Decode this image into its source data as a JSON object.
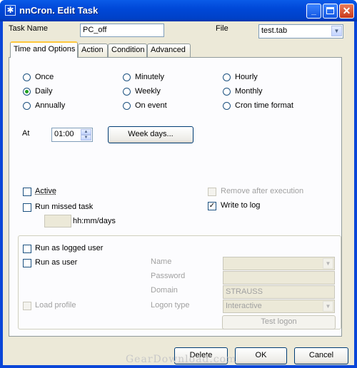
{
  "window": {
    "title": "nnCron. Edit Task"
  },
  "header": {
    "task_name_label": "Task Name",
    "task_name_value": "PC_off",
    "file_label": "File",
    "file_value": "test.tab"
  },
  "tabs": [
    {
      "label": "Time and Options",
      "active": true
    },
    {
      "label": "Action"
    },
    {
      "label": "Condition"
    },
    {
      "label": "Advanced"
    }
  ],
  "schedule": {
    "options": [
      "Once",
      "Minutely",
      "Hourly",
      "Daily",
      "Weekly",
      "Monthly",
      "Annually",
      "On event",
      "Cron time format"
    ],
    "selected": "Daily"
  },
  "time": {
    "at_label": "At",
    "at_value": "01:00",
    "week_days_button": "Week days..."
  },
  "options": {
    "active_label": "Active",
    "run_missed_label": "Run missed task",
    "remove_after_label": "Remove after execution",
    "write_log_label": "Write to log",
    "write_log_checked": true,
    "missed_units": "hh:mm/days"
  },
  "user": {
    "run_logged_label": "Run as logged user",
    "run_as_user_label": "Run as user",
    "load_profile_label": "Load profile",
    "name_label": "Name",
    "password_label": "Password",
    "domain_label": "Domain",
    "domain_value": "STRAUSS",
    "logon_type_label": "Logon type",
    "logon_type_value": "Interactive",
    "test_logon_button": "Test logon"
  },
  "footer": {
    "delete": "Delete",
    "ok": "OK",
    "cancel": "Cancel"
  },
  "watermark": "GearDownload.com",
  "colors": {
    "titlebar": "#0048d8",
    "face": "#ece9d8",
    "panel": "#fcfcfe",
    "tab_highlight": "#ffc73c"
  }
}
